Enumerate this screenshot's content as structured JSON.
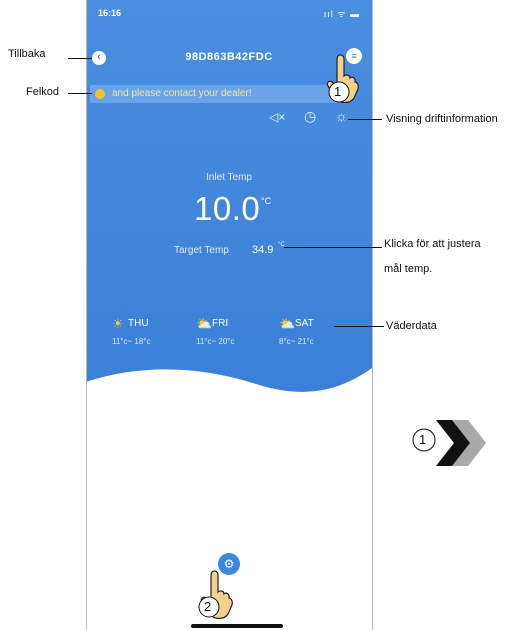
{
  "status_bar": {
    "time": "16:16",
    "icons": "ııl ᯤ ▬"
  },
  "header": {
    "device_id": "98D863B42FDC",
    "back_icon": "‹",
    "menu_icon": "≡"
  },
  "alert": {
    "text": "and please contact your dealer!"
  },
  "toolbar": {
    "mute_icon": "◁×",
    "timer_icon": "◷",
    "info_icon": "☼"
  },
  "temperature": {
    "inlet_label": "Inlet Temp",
    "inlet_value": "10.0",
    "unit": "°C",
    "target_label": "Target Temp",
    "target_value": "34.9"
  },
  "weather": [
    {
      "day": "THU",
      "range": "11°c~ 18°c",
      "icon": "☀"
    },
    {
      "day": "FRI",
      "range": "11°c~ 20°c",
      "icon": "⛅"
    },
    {
      "day": "SAT",
      "range": "8°c~ 21°c",
      "icon": "⛅"
    }
  ],
  "callouts": {
    "back": "Tillbaka",
    "error_code": "Felkod",
    "info": "Visning driftinformation",
    "target_line1": "Klicka för att justera",
    "target_line2": "mål temp.",
    "weather": "Väderdata"
  },
  "markers": {
    "one": "1",
    "two": "2"
  },
  "colors": {
    "accent": "#3a7fd6",
    "alert_dot": "#f2c335"
  }
}
